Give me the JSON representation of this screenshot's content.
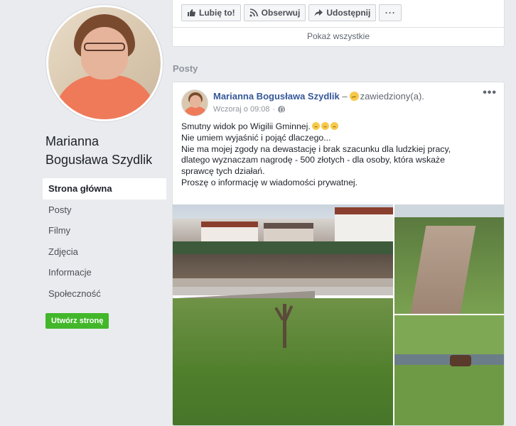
{
  "profile": {
    "name_line1": "Marianna",
    "name_line2": "Bogusława Szydlik"
  },
  "nav": {
    "items": [
      {
        "label": "Strona główna",
        "active": true
      },
      {
        "label": "Posty"
      },
      {
        "label": "Filmy"
      },
      {
        "label": "Zdjęcia"
      },
      {
        "label": "Informacje"
      },
      {
        "label": "Społeczność"
      }
    ],
    "create_page": "Utwórz stronę"
  },
  "top_actions": {
    "like": "Lubię to!",
    "follow": "Obserwuj",
    "share": "Udostępnij",
    "more": "···",
    "show_all": "Pokaż wszystkie"
  },
  "section_title": "Posty",
  "post": {
    "author": "Marianna Bogusława Szydlik",
    "dash": "–",
    "feeling": "zawiedziony(a).",
    "timestamp": "Wczoraj o 09:08",
    "menu": "•••",
    "lines": [
      "Smutny widok po Wigilii Gminnej.",
      "Nie umiem wyjaśnić i pojąć dlaczego...",
      "Nie ma mojej zgody na dewastację i brak szacunku dla ludzkiej pracy,",
      "dlatego wyznaczam nagrodę - 500 złotych - dla osoby, która wskaże",
      "sprawcę tych działań.",
      "Proszę o informację w wiadomości prywatnej."
    ]
  },
  "colors": {
    "link_blue": "#365899",
    "green_button": "#42b72a",
    "background": "#e9ebee"
  }
}
